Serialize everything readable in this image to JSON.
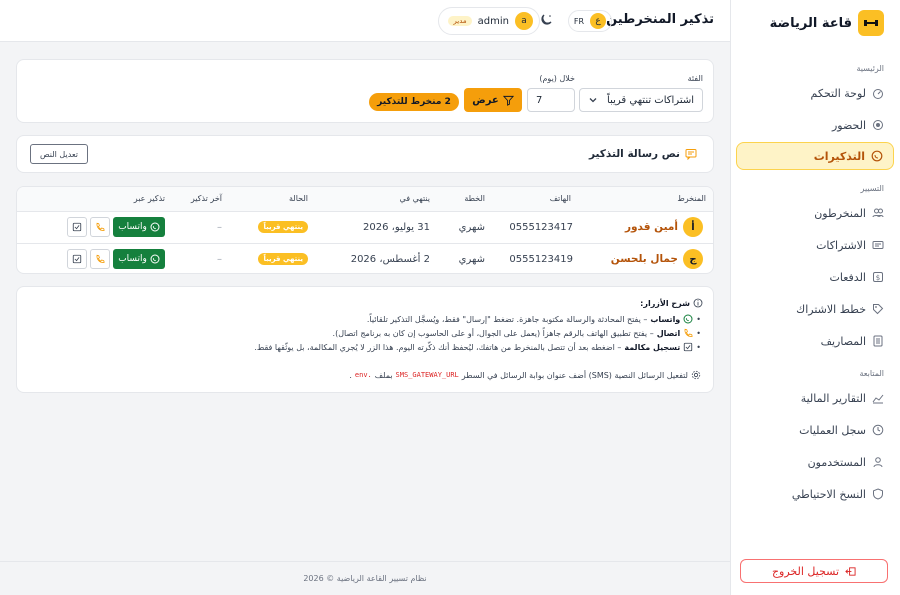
{
  "brand": {
    "name": "قاعة الرياضة"
  },
  "sidebar": {
    "sections": [
      "الرئيسية",
      "التسيير",
      "المتابعة"
    ],
    "items": [
      {
        "label": "لوحة التحكم",
        "icon": "dashboard-icon"
      },
      {
        "label": "الحضور",
        "icon": "attendance-icon"
      },
      {
        "label": "التذكيرات",
        "icon": "whatsapp-icon",
        "active": true
      },
      {
        "label": "المنخرطون",
        "icon": "members-icon"
      },
      {
        "label": "الاشتراكات",
        "icon": "subscriptions-icon"
      },
      {
        "label": "الدفعات",
        "icon": "payments-icon"
      },
      {
        "label": "خطط الاشتراك",
        "icon": "tag-icon"
      },
      {
        "label": "المصاريف",
        "icon": "expenses-icon"
      },
      {
        "label": "التقارير المالية",
        "icon": "chart-icon"
      },
      {
        "label": "سجل العمليات",
        "icon": "clock-icon"
      },
      {
        "label": "المستخدمون",
        "icon": "users-icon"
      },
      {
        "label": "النسخ الاحتياطي",
        "icon": "shield-icon"
      }
    ],
    "logout": "تسجيل الخروج"
  },
  "topbar": {
    "title": "تذكير المنخرطين",
    "lang_code": "FR",
    "lang_avatar": "ع",
    "user_name": "admin",
    "user_avatar": "a",
    "user_role": "مدير"
  },
  "filters": {
    "category_label": "الفئة",
    "category_value": "اشتراكات تنتهي قريباً",
    "days_label": "خلال (يوم)",
    "days_value": "7",
    "show_button": "عرض",
    "count_badge": "2 منخرط للتذكير"
  },
  "message": {
    "title": "نص رسالة التذكير",
    "edit_button": "تعديل النص"
  },
  "table": {
    "headers": [
      "المنخرط",
      "الهاتف",
      "الخطة",
      "ينتهي في",
      "الحالة",
      "آخر تذكير",
      "تذكير عبر"
    ],
    "rows": [
      {
        "avatar": "أ",
        "name": "أمين قدور",
        "phone": "0555123417",
        "plan": "شهري",
        "ends": "31 يوليو، 2026",
        "status": "ينتهي قريباً",
        "last": "–",
        "whatsapp": "واتساب"
      },
      {
        "avatar": "ج",
        "name": "جمال بلحسن",
        "phone": "0555123419",
        "plan": "شهري",
        "ends": "2 أغسطس، 2026",
        "status": "ينتهي قريباً",
        "last": "–",
        "whatsapp": "واتساب"
      }
    ]
  },
  "help": {
    "title": "شرح الأزرار:",
    "lines": [
      {
        "term": "واتساب",
        "text": "– يفتح المحادثة والرسالة مكتوبة جاهزة. تضغط \"إرسال\" فقط، ويُسجَّل التذكير تلقائياً."
      },
      {
        "term": "اتصال",
        "text": "– يفتح تطبيق الهاتف بالرقم جاهزاً (يعمل على الجوال، أو على الحاسوب إن كان به برنامج اتصال)."
      },
      {
        "term": "تسجيل مكالمة",
        "text": "– اضغطه بعد أن تتصل بالمنخرط من هاتفك، ليُحفظ أنك ذكّرته اليوم. هذا الزر لا يُجري المكالمة، بل يوثّقها فقط."
      }
    ],
    "sms_pre": "لتفعيل الرسائل النصية (SMS) أضف عنوان بوابة الرسائل في السطر",
    "sms_code": "SMS_GATEWAY_URL",
    "sms_post": "بملف",
    "sms_file": ".env",
    "sms_end": "."
  },
  "footer": {
    "text": "نظام تسيير القاعة الرياضية © 2026"
  },
  "colors": {
    "accent": "#f59e0b",
    "whatsapp": "#15803d",
    "danger": "#dc2626"
  }
}
